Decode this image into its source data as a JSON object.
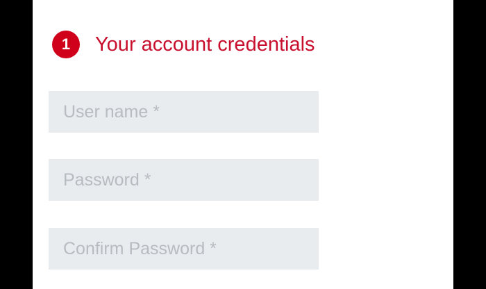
{
  "section": {
    "step_number": "1",
    "title": "Your account credentials"
  },
  "form": {
    "username": {
      "placeholder": "User name *",
      "value": ""
    },
    "password": {
      "placeholder": "Password *",
      "value": ""
    },
    "confirm_password": {
      "placeholder": "Confirm Password *",
      "value": ""
    }
  },
  "colors": {
    "accent": "#c8102e",
    "badge": "#d0021b",
    "field_background": "#e8ecef",
    "placeholder": "#b7bcc0",
    "frame": "#000000",
    "screen": "#ffffff"
  },
  "icons": {
    "step_badge": "numbered-circle-icon"
  }
}
